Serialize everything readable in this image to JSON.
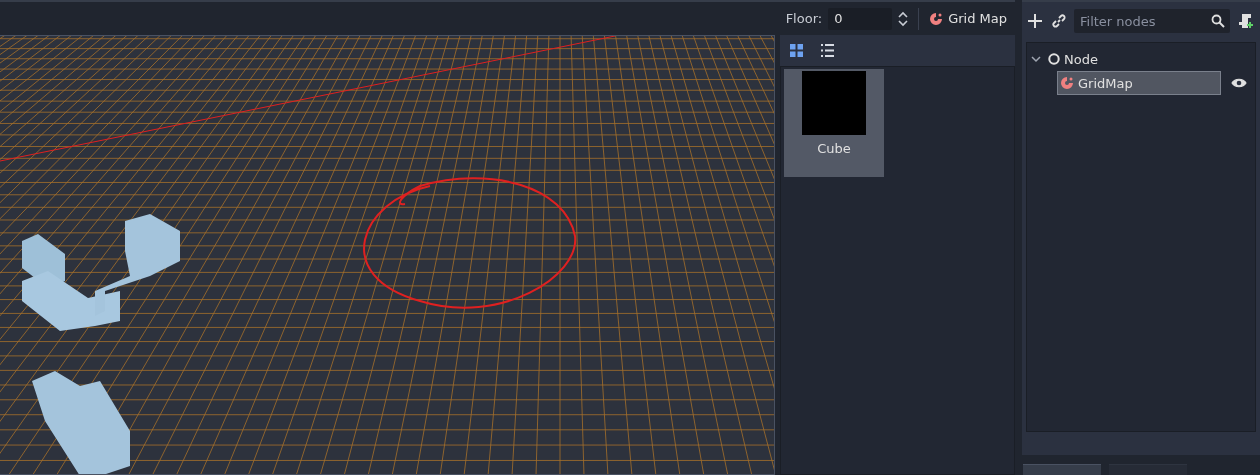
{
  "toolbar": {
    "floor_label": "Floor:",
    "floor_value": "0",
    "gridmap_button": "Grid Map"
  },
  "palette": {
    "view_modes": [
      {
        "kind": "grid",
        "selected": true
      },
      {
        "kind": "list",
        "selected": false
      }
    ],
    "items": [
      {
        "label": "Cube",
        "selected": true
      }
    ]
  },
  "scene": {
    "filter": {
      "placeholder": "Filter nodes"
    },
    "tree": [
      {
        "label": "Node",
        "kind": "node",
        "expanded": true,
        "children": [
          {
            "label": "GridMap",
            "kind": "gridmap",
            "selected": true,
            "visible": true
          }
        ]
      }
    ]
  },
  "dock_tabs": [
    {
      "selected": true
    },
    {
      "selected": false
    }
  ]
}
